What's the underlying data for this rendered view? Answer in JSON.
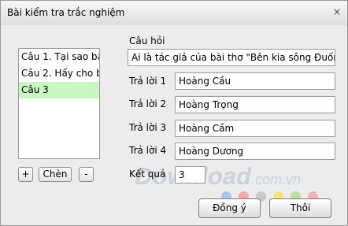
{
  "window": {
    "title": "Bài kiểm tra trắc nghiệm",
    "close_label": "×"
  },
  "questions": {
    "items": [
      {
        "label": "Câu 1. Tại sao bầ",
        "selected": false
      },
      {
        "label": "Câu 2. Hấy cho bi",
        "selected": false
      },
      {
        "label": "Câu 3",
        "selected": true
      }
    ],
    "add_label": "+",
    "insert_label": "Chèn",
    "remove_label": "-"
  },
  "form": {
    "question_label": "Câu hỏi",
    "question_value": "Ai là tác giả của bài thơ \"Bên kia sông Đuống\"",
    "answers": [
      {
        "label": "Trả lời 1",
        "value": "Hoàng Cầu"
      },
      {
        "label": "Trả lời 2",
        "value": "Hoàng Trọng"
      },
      {
        "label": "Trả lời 3",
        "value": "Hoàng Cầm"
      },
      {
        "label": "Trả lời 4",
        "value": "Hoàng Dương"
      }
    ],
    "result_label": "Kết quả",
    "result_value": "3"
  },
  "watermark": {
    "main": "Download",
    "suffix": ".com.vn"
  },
  "dots": [
    "#a8c8ee",
    "#f1aaa9",
    "#c9c9c9",
    "#f6e07e",
    "#b8e0a0",
    "#f2b3b0"
  ],
  "actions": {
    "ok_label": "Đồng ý",
    "cancel_label": "Thôi"
  }
}
